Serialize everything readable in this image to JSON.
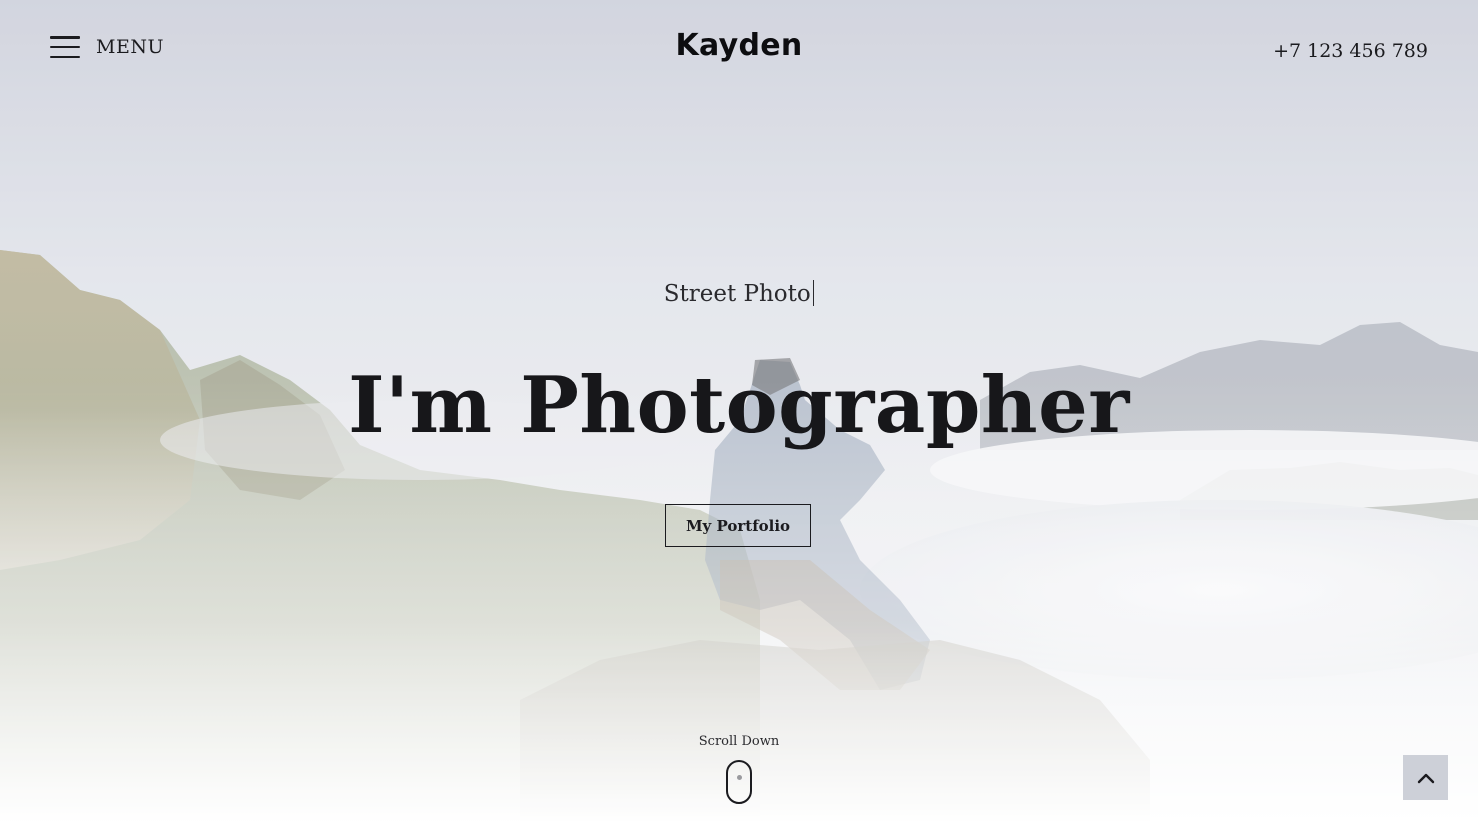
{
  "header": {
    "menu_label": "MENU",
    "logo_text": "Kayden",
    "phone": "+7 123 456 789"
  },
  "hero": {
    "subtitle": "Street Photo",
    "headline": "I'm Photographer",
    "cta_label": "My Portfolio",
    "scroll_label": "Scroll Down"
  },
  "icons": {
    "menu": "hamburger-icon",
    "scroll": "mouse-icon",
    "back_to_top": "chevron-up-icon"
  },
  "colors": {
    "text": "#1b1b1f",
    "back_to_top_bg": "#cdd0d8"
  }
}
